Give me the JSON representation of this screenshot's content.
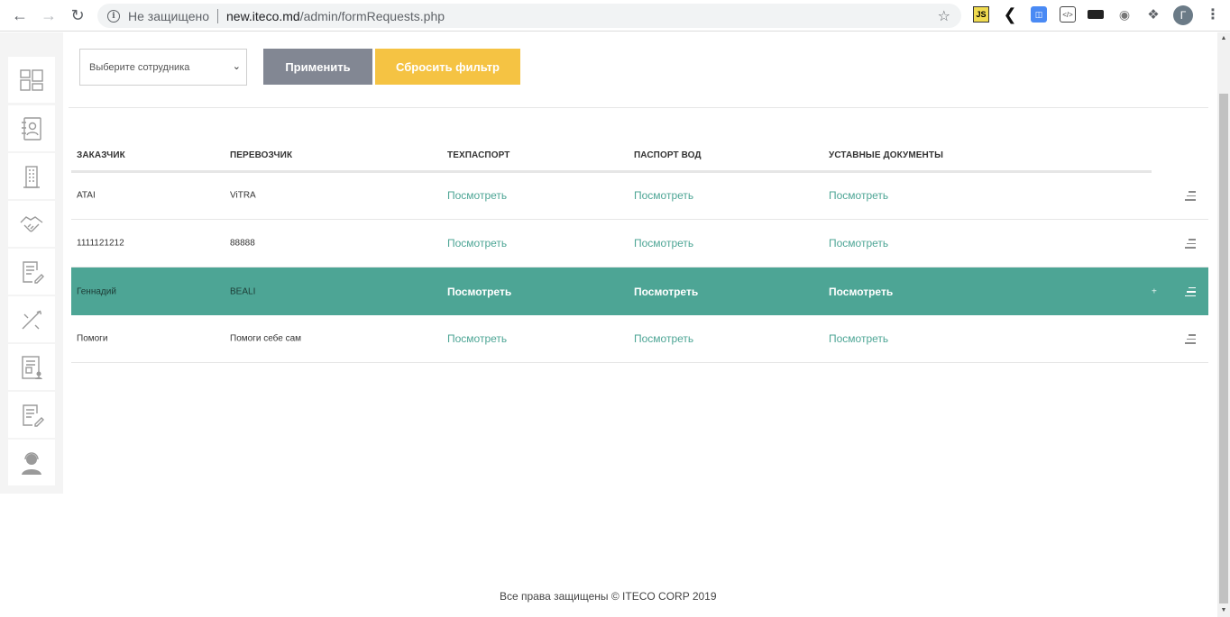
{
  "browser": {
    "not_secure": "Не защищено",
    "url_host": "new.iteco.md",
    "url_path": "/admin/formRequests.php",
    "avatar_letter": "Г"
  },
  "filter": {
    "select_placeholder": "Выберите сотрудника",
    "apply_label": "Применить",
    "reset_label": "Сбросить фильтр"
  },
  "table": {
    "headers": [
      "ЗАКАЗЧИК",
      "ПЕРЕВОЗЧИК",
      "ТЕХПАСПОРТ",
      "ПАСПОРТ ВОД",
      "УСТАВНЫЕ ДОКУМЕНТЫ"
    ],
    "rows": [
      {
        "customer": "ATAI",
        "carrier": "ViTRA",
        "tech": "Посмотреть",
        "driver": "Посмотреть",
        "docs": "Посмотреть"
      },
      {
        "customer": "1111121212",
        "carrier": "88888",
        "tech": "Посмотреть",
        "driver": "Посмотреть",
        "docs": "Посмотреть"
      },
      {
        "customer": "Геннадий",
        "carrier": "BEALI",
        "tech": "Посмотреть",
        "driver": "Посмотреть",
        "docs": "Посмотреть",
        "plus": "+"
      },
      {
        "customer": "Помоги",
        "carrier": "Помоги себе сам",
        "tech": "Посмотреть",
        "driver": "Посмотреть",
        "docs": "Посмотреть"
      }
    ]
  },
  "footer": {
    "text": "Все права защищены © ITECO CORP 2019"
  },
  "colors": {
    "accent": "#4da595",
    "apply": "#828793",
    "reset": "#f5c343"
  }
}
